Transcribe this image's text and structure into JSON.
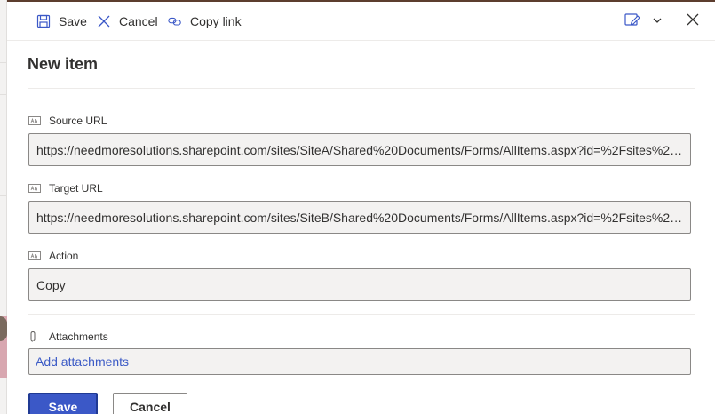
{
  "toolbar": {
    "save_label": "Save",
    "cancel_label": "Cancel",
    "copy_link_label": "Copy link",
    "icons": {
      "save": "save-icon",
      "cancel": "close-x-icon",
      "copy_link": "link-icon",
      "edit_form": "edit-form-icon",
      "dropdown": "chevron-down-icon",
      "close": "close-icon"
    }
  },
  "form": {
    "title": "New item",
    "fields": [
      {
        "label": "Source URL",
        "icon": "text-field-icon",
        "value": "https://needmoresolutions.sharepoint.com/sites/SiteA/Shared%20Documents/Forms/AllItems.aspx?id=%2Fsites%2FS..."
      },
      {
        "label": "Target URL",
        "icon": "text-field-icon",
        "value": "https://needmoresolutions.sharepoint.com/sites/SiteB/Shared%20Documents/Forms/AllItems.aspx?id=%2Fsites%2FS..."
      },
      {
        "label": "Action",
        "icon": "text-field-icon",
        "value": "Copy"
      }
    ],
    "attachments": {
      "label": "Attachments",
      "icon": "paperclip-icon",
      "link": "Add attachments"
    }
  },
  "footer": {
    "save_label": "Save",
    "cancel_label": "Cancel"
  },
  "colors": {
    "primary": "#3b58c7",
    "link": "#3c5bc6",
    "input_bg": "#f3f2f1",
    "input_border": "#8a8886",
    "text": "#323130"
  }
}
